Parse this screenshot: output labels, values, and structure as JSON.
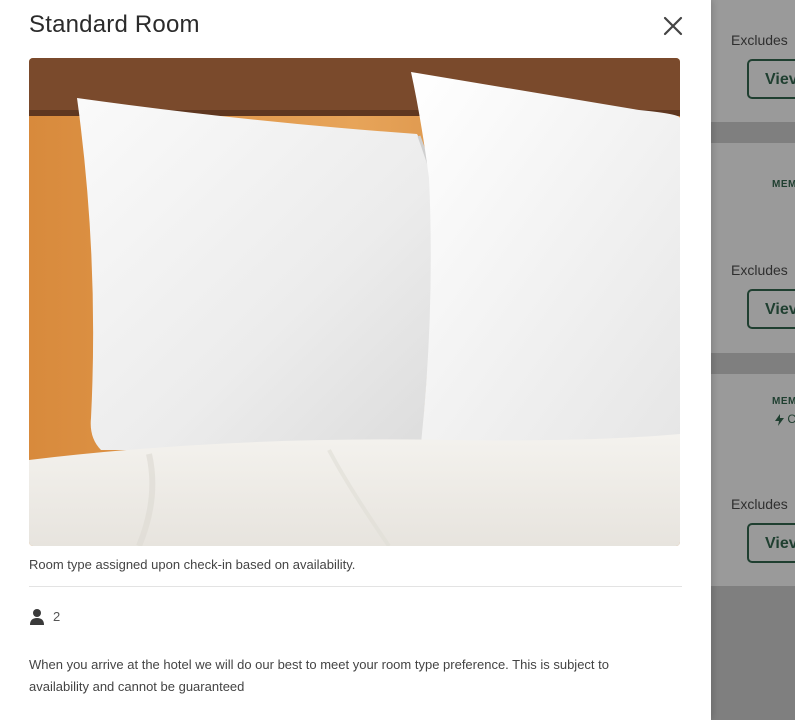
{
  "modal": {
    "title": "Standard Room",
    "caption": "Room type assigned upon check-in based on availability.",
    "occupancy": "2",
    "note": "When you arrive at the hotel we will do our best to meet your room type preference. This is subject to availability and cannot be guaranteed",
    "icons": {
      "close": "close-icon",
      "guest": "person-icon"
    }
  },
  "background": {
    "cards": [
      {
        "excludes": "Excludes",
        "view": "Viev"
      },
      {
        "member": "MEM",
        "excludes": "Excludes",
        "view": "Viev"
      },
      {
        "member": "MEM",
        "bolt_text": "C",
        "excludes": "Excludes",
        "view": "Viev"
      }
    ]
  },
  "colors": {
    "accent": "#1f3f30",
    "overlay": "#8c8c8c"
  }
}
